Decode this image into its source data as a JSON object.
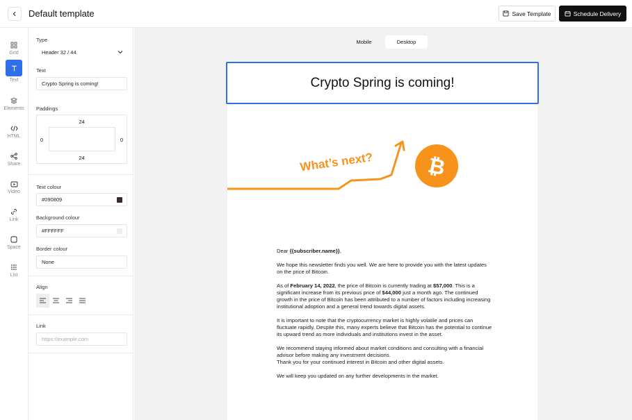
{
  "topbar": {
    "title": "Default template",
    "save_label": "Save Template",
    "schedule_label": "Schedule Delivery"
  },
  "rail": {
    "items": [
      {
        "label": "Grid",
        "icon": "grid-icon"
      },
      {
        "label": "Text",
        "icon": "text-icon"
      },
      {
        "label": "Elements",
        "icon": "layers-icon"
      },
      {
        "label": "HTML",
        "icon": "code-icon"
      },
      {
        "label": "Share",
        "icon": "share-icon"
      },
      {
        "label": "Video",
        "icon": "video-icon"
      },
      {
        "label": "Link",
        "icon": "link-icon"
      },
      {
        "label": "Space",
        "icon": "square-icon"
      },
      {
        "label": "List",
        "icon": "list-icon"
      }
    ]
  },
  "panel": {
    "type_label": "Type",
    "type_value": "Header 32 / 44",
    "text_label": "Text",
    "text_value": "Crypto Spring is coming!",
    "paddings_label": "Paddings",
    "padding_top": "24",
    "padding_left": "0",
    "padding_right": "0",
    "padding_bottom": "24",
    "text_colour_label": "Text colour",
    "text_colour_value": "#090809",
    "bg_colour_label": "Background colour",
    "bg_colour_value": "#FFFFFF",
    "border_colour_label": "Border colour",
    "border_colour_value": "None",
    "align_label": "Align",
    "link_label": "Link",
    "link_placeholder": "https://example.com"
  },
  "canvas": {
    "tab_mobile": "Mobile",
    "tab_desktop": "Desktop",
    "header_text": "Crypto Spring is coming!",
    "hero_text": "What’s next?",
    "greeting_prefix": "Dear ",
    "greeting_name": "{{subscriber.name}}",
    "greeting_suffix": ",",
    "p1": "We hope this newsletter finds you well. We are here to provide you with the latest updates on the price of Bitcoin.",
    "p2_a": "As of ",
    "p2_date": "February 14, 2022",
    "p2_b": ", the price of Bitcoin is currently trading at ",
    "p2_price": "$57,000",
    "p2_c": ". This is a significant increase from its previous price of ",
    "p2_prev": "$44,000",
    "p2_d": " just a month ago. The continued growth in the price of Bitcoin has been attributed to a number of factors including increasing institutional adoption and a general trend towards digital assets.",
    "p3": "It is important to note that the cryptocurrency market is highly volatile and prices can fluctuate rapidly. Despite this, many experts believe that Bitcoin has the potential to continue its upward trend as more individuals and institutions invest in the asset.",
    "p4_a": "We recommend staying informed about market conditions and consulting with a financial advisor before making any investment decisions.",
    "p4_b": "Thank you for your continued interest in Bitcoin and other digital assets.",
    "p5": "We will keep you updated on any further developments in the market."
  },
  "colors": {
    "accent": "#2f6fea",
    "orange": "#f7931a",
    "text_colour_swatch": "#3a2a2e",
    "bg_colour_swatch": "#eeeeee"
  }
}
